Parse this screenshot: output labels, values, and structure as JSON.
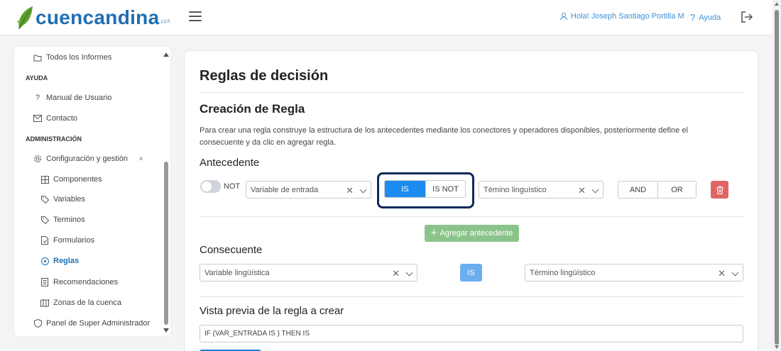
{
  "app": {
    "logo_text": "cuencandina",
    "logo_version": "v.2.0"
  },
  "topbar": {
    "user_greeting": "Hola! Joseph Santiago Portilla M",
    "help_label": "Ayuda"
  },
  "sidebar": {
    "items": [
      {
        "label": "Todos los Informes",
        "icon": "folder-icon"
      },
      {
        "section": "AYUDA"
      },
      {
        "label": "Manual de Usuario",
        "icon": "question-icon"
      },
      {
        "label": "Contacto",
        "icon": "mail-icon"
      },
      {
        "section": "ADMINISTRACIÓN"
      },
      {
        "label": "Configuración y gestión",
        "icon": "gear-icon"
      },
      {
        "label": "Componentes",
        "icon": "grid-icon"
      },
      {
        "label": "Variables",
        "icon": "tag-icon"
      },
      {
        "label": "Terminos",
        "icon": "tag-icon"
      },
      {
        "label": "Formularios",
        "icon": "document-icon"
      },
      {
        "label": "Reglas",
        "icon": "compass-icon",
        "active": true
      },
      {
        "label": "Recomendaciones",
        "icon": "list-icon"
      },
      {
        "label": "Zonas de la cuenca",
        "icon": "map-icon"
      },
      {
        "label": "Panel de Super Administrador",
        "icon": "shield-icon"
      }
    ]
  },
  "main": {
    "title": "Reglas de decisión",
    "section_title": "Creación de Regla",
    "description": "Para crear una regla construye la estructura de los antecedentes mediante los conectores y operadores disponibles, posteriormente define el consecuente y da clic en agregar regla.",
    "antecedent": {
      "heading": "Antecedente",
      "not_label": "NOT",
      "input_variable_value": "Variable de entrada",
      "operator_options": [
        "IS",
        "IS NOT"
      ],
      "operator_selected": "IS",
      "linguistic_term_value": "Témino linguístico",
      "connector_options": [
        "AND",
        "OR"
      ],
      "add_label": "Agregar antecedente"
    },
    "consequent": {
      "heading": "Consecuente",
      "variable_value": "Variable lingüística",
      "operator_label": "IS",
      "term_value": "Término lingüístico"
    },
    "preview": {
      "heading": "Vista previa de la regla a crear",
      "value": "IF (VAR_ENTRADA IS ) THEN  IS"
    }
  },
  "colors": {
    "brand": "#1f6fb2",
    "accent": "#1d8cf0",
    "success": "#8bc48a",
    "danger": "#e06666",
    "highlight": "#0b2a5b"
  }
}
